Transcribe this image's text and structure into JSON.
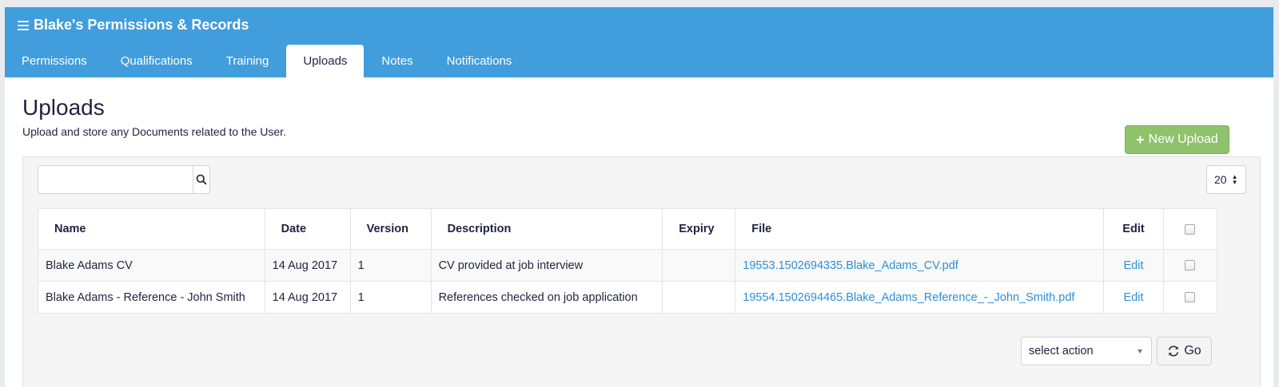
{
  "header": {
    "title": "Blake's Permissions & Records",
    "tabs": [
      "Permissions",
      "Qualifications",
      "Training",
      "Uploads",
      "Notes",
      "Notifications"
    ],
    "active_tab": "Uploads"
  },
  "main": {
    "title": "Uploads",
    "subtitle": "Upload and store any Documents related to the User.",
    "new_upload_label": "New Upload",
    "search": {
      "value": "",
      "placeholder": ""
    },
    "page_size": "20",
    "table": {
      "columns": [
        "Name",
        "Date",
        "Version",
        "Description",
        "Expiry",
        "File",
        "Edit"
      ],
      "rows": [
        {
          "name": "Blake Adams CV",
          "date": "14 Aug 2017",
          "version": "1",
          "description": "CV provided at job interview",
          "expiry": "",
          "file": "19553.1502694335.Blake_Adams_CV.pdf",
          "edit": "Edit"
        },
        {
          "name": "Blake Adams - Reference - John Smith",
          "date": "14 Aug 2017",
          "version": "1",
          "description": "References checked on job application",
          "expiry": "",
          "file": "19554.1502694465.Blake_Adams_Reference_-_John_Smith.pdf",
          "edit": "Edit"
        }
      ]
    },
    "action_select": "select action",
    "go_label": "Go"
  },
  "colors": {
    "header": "#419ddb",
    "new_upload": "#8ec26b",
    "link": "#2d8fd6"
  }
}
